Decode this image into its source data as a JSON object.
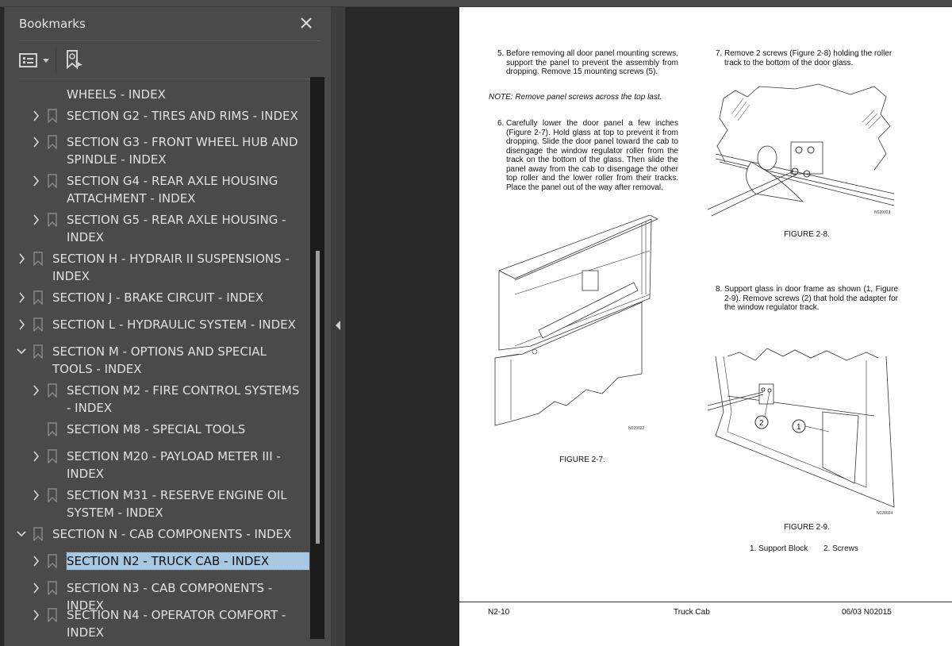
{
  "bookmarks_panel": {
    "title": "Bookmarks",
    "close_icon": "close-icon",
    "toolbar": {
      "options_icon": "list-options-icon",
      "dropdown_icon": "chevron-down-icon",
      "find_bookmark_icon": "find-current-bookmark-icon"
    },
    "items": [
      {
        "label": "WHEELS - INDEX",
        "continued": true,
        "level": 1,
        "expanded": null,
        "selected": false
      },
      {
        "label": "SECTION G2 - TIRES AND RIMS - INDEX",
        "level": 1,
        "expanded": false,
        "selected": false
      },
      {
        "label": "SECTION G3 - FRONT WHEEL HUB AND SPINDLE - INDEX",
        "level": 1,
        "expanded": false,
        "selected": false
      },
      {
        "label": "SECTION G4 - REAR AXLE HOUSING ATTACHMENT - INDEX",
        "level": 1,
        "expanded": false,
        "selected": false
      },
      {
        "label": "SECTION G5 - REAR AXLE HOUSING - INDEX",
        "level": 1,
        "expanded": false,
        "selected": false
      },
      {
        "label": "SECTION H - HYDRAIR II SUSPENSIONS - INDEX",
        "level": 0,
        "expanded": false,
        "selected": false
      },
      {
        "label": "SECTION J - BRAKE CIRCUIT - INDEX",
        "level": 0,
        "expanded": false,
        "selected": false
      },
      {
        "label": "SECTION L - HYDRAULIC SYSTEM - INDEX",
        "level": 0,
        "expanded": false,
        "selected": false
      },
      {
        "label": "SECTION M - OPTIONS AND SPECIAL TOOLS - INDEX",
        "level": 0,
        "expanded": true,
        "selected": false
      },
      {
        "label": "SECTION M2 - FIRE CONTROL SYSTEMS - INDEX",
        "level": 1,
        "expanded": false,
        "selected": false
      },
      {
        "label": "SECTION M8 - SPECIAL TOOLS",
        "level": 1,
        "expanded": null,
        "selected": false
      },
      {
        "label": "SECTION M20 - PAYLOAD METER III - INDEX",
        "level": 1,
        "expanded": false,
        "selected": false
      },
      {
        "label": "SECTION M31 - RESERVE ENGINE OIL SYSTEM - INDEX",
        "level": 1,
        "expanded": false,
        "selected": false
      },
      {
        "label": "SECTION N - CAB COMPONENTS - INDEX",
        "level": 0,
        "expanded": true,
        "selected": false
      },
      {
        "label": "SECTION N2 - TRUCK CAB - INDEX",
        "level": 1,
        "expanded": false,
        "selected": true
      },
      {
        "label": "SECTION N3 - CAB COMPONENTS - INDEX",
        "level": 1,
        "expanded": false,
        "selected": false
      },
      {
        "label": "SECTION N4 - OPERATOR COMFORT - INDEX",
        "level": 1,
        "expanded": false,
        "selected": false
      }
    ],
    "scroll": {
      "thumb_start_fraction": 0.31,
      "thumb_end_fraction": 0.83
    }
  },
  "colors": {
    "panel_bg": "#4a4a4a",
    "viewer_bg": "#282828",
    "selection": "#a6c8e3",
    "text": "#e0e0e0"
  },
  "document": {
    "step5": {
      "num": "5.",
      "text": "Before removing all door panel mounting screws, support the panel to prevent the assembly from dropping. Remove 15 mounting screws (5)."
    },
    "note": "NOTE: Remove panel screws across the top last.",
    "step6": {
      "num": "6.",
      "text": "Carefully lower the door panel a few inches (Figure 2-7). Hold glass at top to prevent it from dropping. Slide the door panel toward the cab to disengage the window regulator roller from the track on the bottom of the glass. Then slide the panel away from the cab to disengage the other top roller and the lower roller from their tracks. Place the panel out of the way after removal."
    },
    "step7": {
      "num": "7.",
      "text": "Remove 2 screws (Figure 2-8) holding the roller track to the bottom of the door glass."
    },
    "step8": {
      "num": "8.",
      "text": "Support glass in door frame as shown (1, Figure 2-9). Remove screws (2) that hold the adapter for the window regulator track."
    },
    "figures": {
      "fig7": {
        "caption": "FIGURE 2-7.",
        "code": "N020022"
      },
      "fig8": {
        "caption": "FIGURE 2-8.",
        "code": "N020023"
      },
      "fig9": {
        "caption": "FIGURE 2-9.",
        "code": "N020024",
        "callout1": "1",
        "callout2": "2"
      }
    },
    "legend": {
      "item1": "1. Support Block",
      "item2": "2. Screws"
    },
    "footer": {
      "left": "N2-10",
      "center": "Truck Cab",
      "right": "06/03  N02015"
    }
  }
}
